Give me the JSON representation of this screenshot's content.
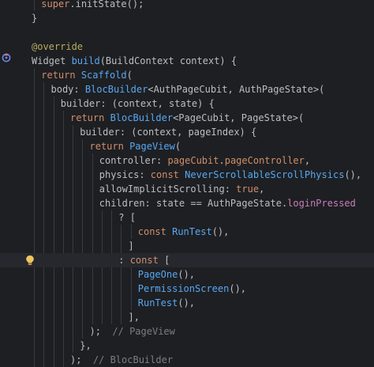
{
  "editor": {
    "lines": [
      {
        "indent": 1,
        "tokens": [
          {
            "t": "super",
            "c": "kw"
          },
          {
            "t": ".initState();",
            "c": "txt"
          }
        ]
      },
      {
        "indent": 0,
        "tokens": [
          {
            "t": "}",
            "c": "txt"
          }
        ]
      },
      {
        "indent": 0,
        "tokens": []
      },
      {
        "indent": 0,
        "tokens": [
          {
            "t": "@override",
            "c": "ann"
          }
        ]
      },
      {
        "indent": 0,
        "tokens": [
          {
            "t": "Widget ",
            "c": "txt"
          },
          {
            "t": "build",
            "c": "fn"
          },
          {
            "t": "(BuildContext context) {",
            "c": "txt"
          }
        ]
      },
      {
        "indent": 1,
        "tokens": [
          {
            "t": "return ",
            "c": "kw"
          },
          {
            "t": "Scaffold",
            "c": "fn"
          },
          {
            "t": "(",
            "c": "txt"
          }
        ]
      },
      {
        "indent": 2,
        "tokens": [
          {
            "t": "body: ",
            "c": "txt"
          },
          {
            "t": "BlocBuilder",
            "c": "fn"
          },
          {
            "t": "<AuthPageCubit, AuthPageState>(",
            "c": "txt"
          }
        ]
      },
      {
        "indent": 3,
        "tokens": [
          {
            "t": "builder: (context, state) {",
            "c": "txt"
          }
        ]
      },
      {
        "indent": 4,
        "tokens": [
          {
            "t": "return ",
            "c": "kw"
          },
          {
            "t": "BlocBuilder",
            "c": "fn"
          },
          {
            "t": "<PageCubit, PageState>(",
            "c": "txt"
          }
        ]
      },
      {
        "indent": 5,
        "tokens": [
          {
            "t": "builder: (context, pageIndex) {",
            "c": "txt"
          }
        ]
      },
      {
        "indent": 6,
        "tokens": [
          {
            "t": "return ",
            "c": "kw"
          },
          {
            "t": "PageView",
            "c": "fn"
          },
          {
            "t": "(",
            "c": "txt"
          }
        ]
      },
      {
        "indent": 7,
        "tokens": [
          {
            "t": "controller: ",
            "c": "txt"
          },
          {
            "t": "pageCubit",
            "c": "kw"
          },
          {
            "t": ".",
            "c": "txt"
          },
          {
            "t": "pageController",
            "c": "kw"
          },
          {
            "t": ",",
            "c": "txt"
          }
        ]
      },
      {
        "indent": 7,
        "tokens": [
          {
            "t": "physics: ",
            "c": "txt"
          },
          {
            "t": "const ",
            "c": "kw"
          },
          {
            "t": "NeverScrollableScrollPhysics",
            "c": "fn"
          },
          {
            "t": "(),",
            "c": "txt"
          }
        ]
      },
      {
        "indent": 7,
        "tokens": [
          {
            "t": "allowImplicitScrolling: ",
            "c": "txt"
          },
          {
            "t": "true",
            "c": "kw"
          },
          {
            "t": ",",
            "c": "txt"
          }
        ]
      },
      {
        "indent": 7,
        "tokens": [
          {
            "t": "children: state == AuthPageState.",
            "c": "txt"
          },
          {
            "t": "loginPressed",
            "c": "prop"
          }
        ]
      },
      {
        "indent": 9,
        "tokens": [
          {
            "t": "? [",
            "c": "txt"
          }
        ]
      },
      {
        "indent": 11,
        "tokens": [
          {
            "t": "const ",
            "c": "kw"
          },
          {
            "t": "RunTest",
            "c": "fn"
          },
          {
            "t": "(),",
            "c": "txt"
          }
        ]
      },
      {
        "indent": 10,
        "tokens": [
          {
            "t": "]",
            "c": "txt"
          }
        ]
      },
      {
        "indent": 9,
        "tokens": [
          {
            "t": ": ",
            "c": "txt"
          },
          {
            "t": "const ",
            "c": "kw"
          },
          {
            "t": "[",
            "c": "txt"
          }
        ]
      },
      {
        "indent": 11,
        "tokens": [
          {
            "t": "PageOne",
            "c": "fn"
          },
          {
            "t": "(),",
            "c": "txt"
          }
        ]
      },
      {
        "indent": 11,
        "tokens": [
          {
            "t": "PermissionScreen",
            "c": "fn"
          },
          {
            "t": "(),",
            "c": "txt"
          }
        ]
      },
      {
        "indent": 11,
        "tokens": [
          {
            "t": "RunTest",
            "c": "fn"
          },
          {
            "t": "(),",
            "c": "txt"
          }
        ]
      },
      {
        "indent": 10,
        "tokens": [
          {
            "t": "],",
            "c": "txt"
          }
        ]
      },
      {
        "indent": 6,
        "tokens": [
          {
            "t": ");  ",
            "c": "txt"
          },
          {
            "t": "// PageView",
            "c": "cmt"
          }
        ]
      },
      {
        "indent": 5,
        "tokens": [
          {
            "t": "},",
            "c": "txt"
          }
        ]
      },
      {
        "indent": 4,
        "tokens": [
          {
            "t": ");  ",
            "c": "txt"
          },
          {
            "t": "// BlocBuilder",
            "c": "cmt"
          }
        ]
      }
    ],
    "current_line": 18,
    "colors": {
      "background": "#1e1f22",
      "keyword": "#cf8e6d",
      "function": "#56a8f5",
      "annotation": "#b3ae60",
      "property": "#c77dbb",
      "comment": "#7a7e85",
      "text": "#bcbec4"
    },
    "gutter_icons": [
      {
        "line": 4,
        "icon": "override-method-icon"
      },
      {
        "line": 18,
        "icon": "intention-bulb-icon"
      }
    ]
  }
}
